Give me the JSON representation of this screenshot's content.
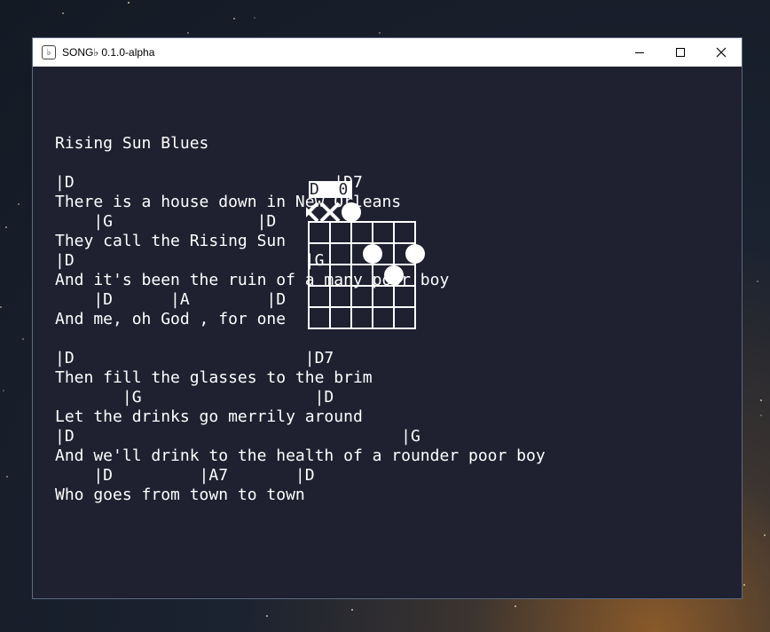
{
  "window": {
    "title": "SONG♭ 0.1.0-alpha",
    "icon": "app-logo-icon",
    "controls": [
      "minimize-icon",
      "maximize-icon",
      "close-icon"
    ]
  },
  "song": {
    "lines": [
      "Rising Sun Blues",
      "",
      "|D                           |D7",
      "There is a house down in New Orleans",
      "    |G               |D",
      "They call the Rising Sun",
      "|D                        |G",
      "And it's been the ruin of a many poor boy",
      "    |D      |A        |D",
      "And me, oh God , for one",
      "",
      "|D                        |D7",
      "Then fill the glasses to the brim",
      "       |G                  |D",
      "Let the drinks go merrily around",
      "|D                                  |G",
      "And we'll drink to the health of a rounder poor boy",
      "    |D         |A7       |D",
      "Who goes from town to town"
    ]
  },
  "chord_diagram": {
    "name": "D",
    "fret_label": "0",
    "muted_strings": [
      1,
      2
    ],
    "open_strings": [
      3
    ],
    "fingers": [
      {
        "string": 4,
        "fret": 2
      },
      {
        "string": 6,
        "fret": 2
      },
      {
        "string": 5,
        "fret": 3
      }
    ],
    "strings": 6,
    "frets": 5
  }
}
